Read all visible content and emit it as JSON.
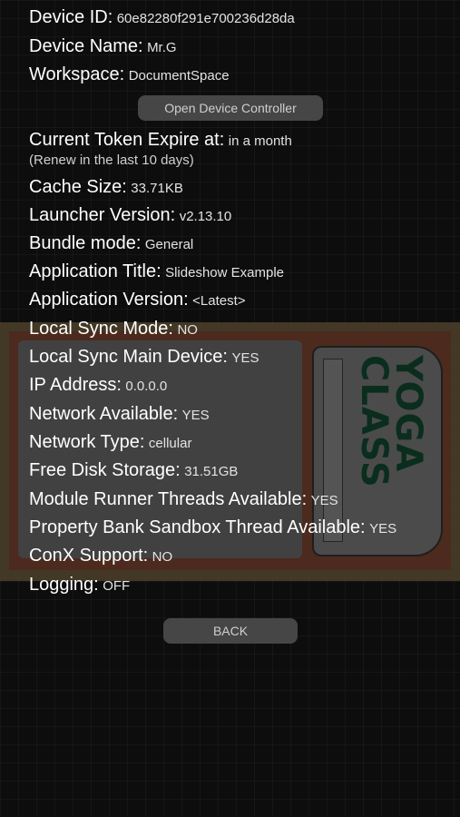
{
  "rows_top": [
    {
      "label": "Device ID:",
      "value": "60e82280f291e700236d28da"
    },
    {
      "label": "Device Name:",
      "value": "Mr.G"
    },
    {
      "label": "Workspace:",
      "value": "DocumentSpace"
    }
  ],
  "open_controller_button": "Open Device Controller",
  "token": {
    "label": "Current Token Expire at:",
    "value": "in a month",
    "note": "(Renew in the last 10 days)"
  },
  "rows_bottom": [
    {
      "label": "Cache Size:",
      "value": "33.71KB"
    },
    {
      "label": "Launcher Version:",
      "value": "v2.13.10"
    },
    {
      "label": "Bundle mode:",
      "value": "General"
    },
    {
      "label": "Application Title:",
      "value": "Slideshow Example"
    },
    {
      "label": "Application Version:",
      "value": "<Latest>"
    },
    {
      "label": "Local Sync Mode:",
      "value": "NO"
    },
    {
      "label": "Local Sync Main Device:",
      "value": "YES"
    },
    {
      "label": "IP Address:",
      "value": "0.0.0.0"
    },
    {
      "label": "Network Available:",
      "value": "YES"
    },
    {
      "label": "Network Type:",
      "value": "cellular"
    },
    {
      "label": "Free Disk Storage:",
      "value": "31.51GB"
    },
    {
      "label": "Module Runner Threads Available:",
      "value": "YES"
    },
    {
      "label": "Property Bank Sandbox Thread Available:",
      "value": "YES"
    },
    {
      "label": "ConX Support:",
      "value": "NO"
    },
    {
      "label": "Logging:",
      "value": "OFF"
    }
  ],
  "back_button": "BACK",
  "poster": {
    "logo_text": "YOGA CLASS"
  },
  "colors": {
    "background": "#0d0d0d",
    "button": "#464646",
    "poster_logo": "#0f3f2b"
  }
}
